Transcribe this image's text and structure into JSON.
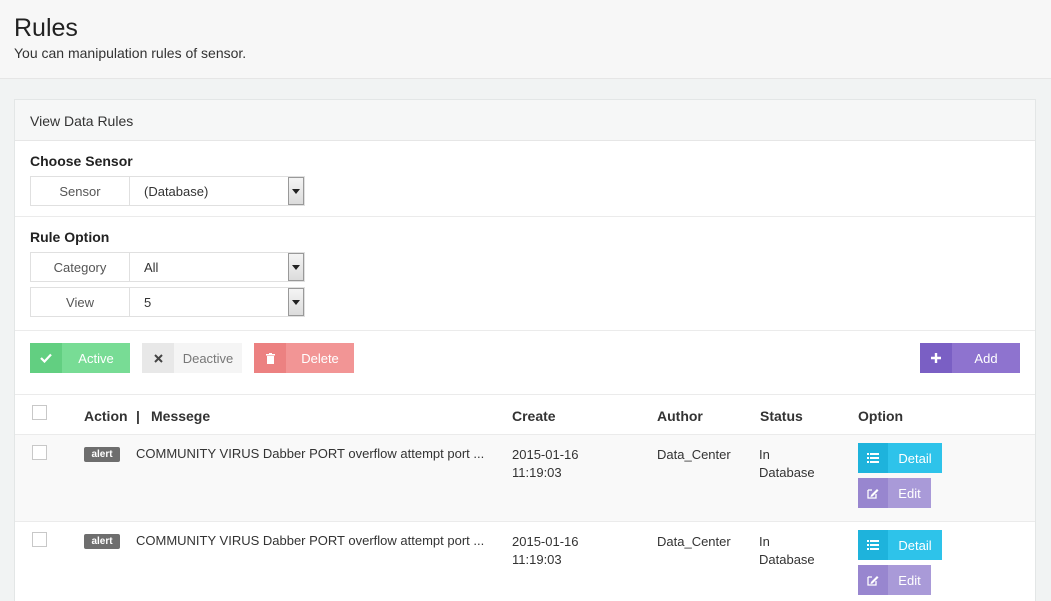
{
  "header": {
    "title": "Rules",
    "subtitle": "You can manipulation rules of sensor."
  },
  "panel": {
    "heading": "View Data Rules"
  },
  "choose_sensor": {
    "label": "Choose Sensor",
    "sensor_label": "Sensor",
    "sensor_value": "(Database)"
  },
  "rule_option": {
    "label": "Rule Option",
    "category_label": "Category",
    "category_value": "All",
    "view_label": "View",
    "view_value": "5"
  },
  "actions": {
    "active": "Active",
    "deactive": "Deactive",
    "delete": "Delete",
    "add": "Add"
  },
  "table": {
    "headers": {
      "action": "Action",
      "separator": "|",
      "message": "Messege",
      "create": "Create",
      "author": "Author",
      "status": "Status",
      "option": "Option"
    },
    "rows": [
      {
        "badge": "alert",
        "message": "COMMUNITY VIRUS Dabber PORT overflow attempt port ...",
        "create_date": "2015-01-16",
        "create_time": "11:19:03",
        "author": "Data_Center",
        "status_line1": "In",
        "status_line2": "Database",
        "detail_label": "Detail",
        "edit_label": "Edit"
      },
      {
        "badge": "alert",
        "message": "COMMUNITY VIRUS Dabber PORT overflow attempt port ...",
        "create_date": "2015-01-16",
        "create_time": "11:19:03",
        "author": "Data_Center",
        "status_line1": "In",
        "status_line2": "Database",
        "detail_label": "Detail",
        "edit_label": "Edit"
      }
    ]
  },
  "colors": {
    "active": "#78dc95",
    "delete": "#f29595",
    "add": "#8e73cf",
    "detail": "#2ec3ea",
    "edit": "#a99ad8"
  }
}
